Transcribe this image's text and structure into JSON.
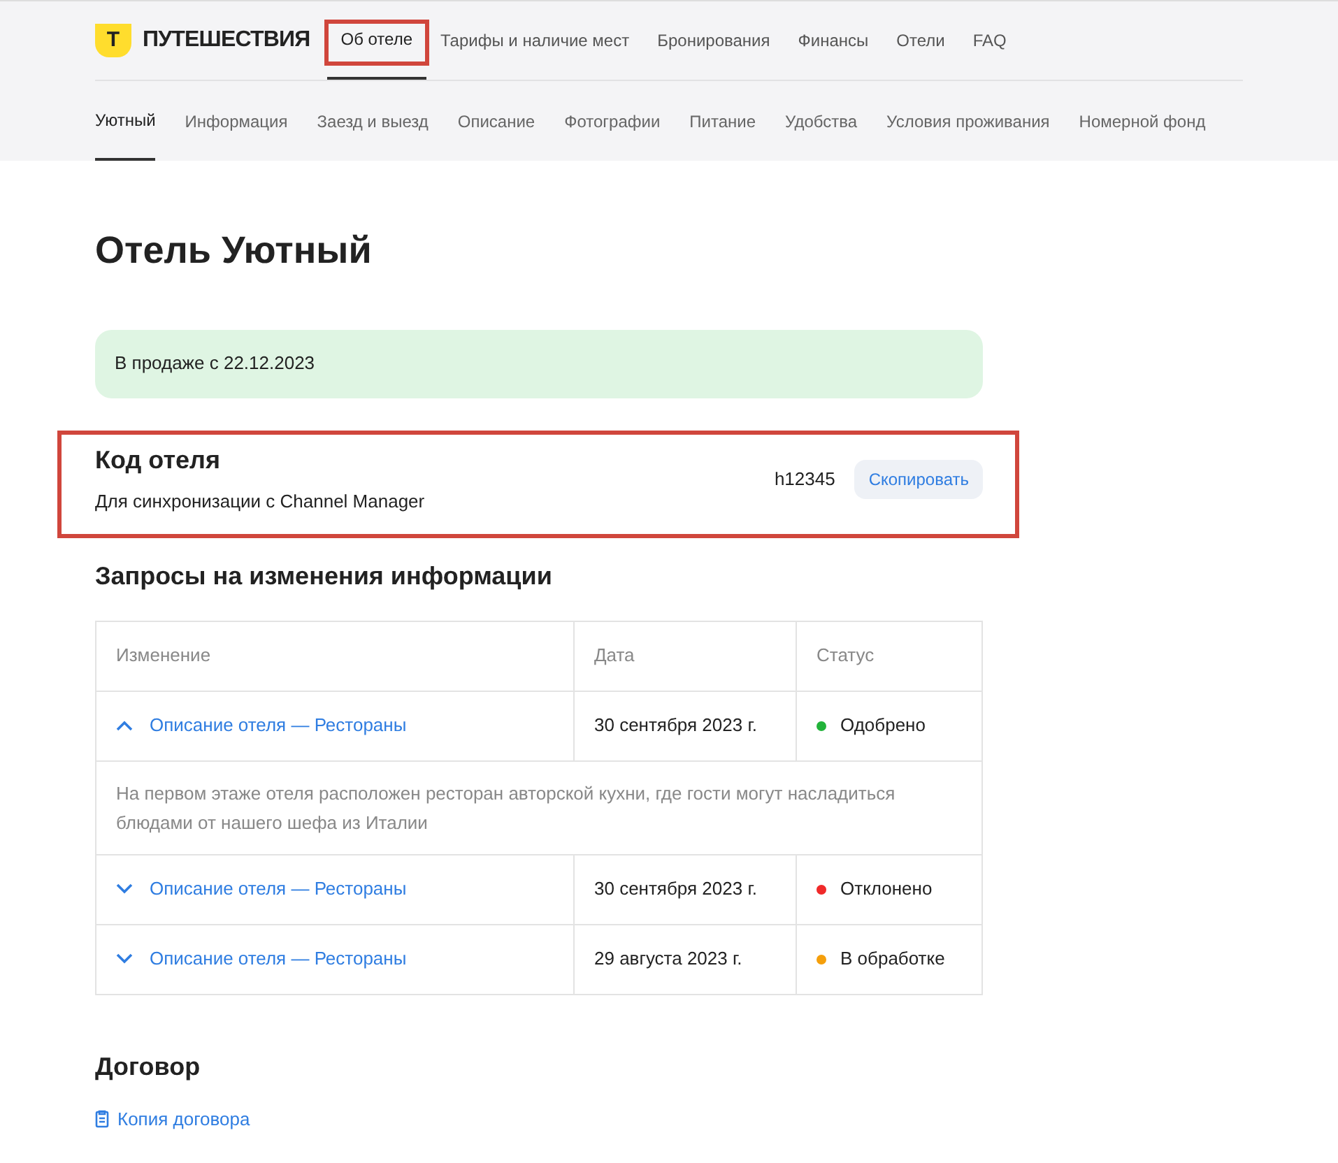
{
  "logo": {
    "mark": "Т",
    "text": "ПУТЕШЕСТВИЯ"
  },
  "top_nav": [
    {
      "label": "Об отеле",
      "selected": true,
      "highlighted": true
    },
    {
      "label": "Тарифы и наличие мест",
      "selected": false,
      "highlighted": false
    },
    {
      "label": "Бронирования",
      "selected": false,
      "highlighted": false
    },
    {
      "label": "Финансы",
      "selected": false,
      "highlighted": false
    },
    {
      "label": "Отели",
      "selected": false,
      "highlighted": false
    },
    {
      "label": "FAQ",
      "selected": false,
      "highlighted": false
    }
  ],
  "sub_nav": [
    {
      "label": "Уютный",
      "selected": true
    },
    {
      "label": "Информация",
      "selected": false
    },
    {
      "label": "Заезд и выезд",
      "selected": false
    },
    {
      "label": "Описание",
      "selected": false
    },
    {
      "label": "Фотографии",
      "selected": false
    },
    {
      "label": "Питание",
      "selected": false
    },
    {
      "label": "Удобства",
      "selected": false
    },
    {
      "label": "Условия проживания",
      "selected": false
    },
    {
      "label": "Номерной фонд",
      "selected": false
    }
  ],
  "title": "Отель Уютный",
  "sale_notice": "В продаже с 22.12.2023",
  "hotel_code": {
    "title": "Код отеля",
    "subtitle": "Для синхронизации с Channel Manager",
    "code": "h12345",
    "button": "Скопировать",
    "highlighted": true
  },
  "requests": {
    "title": "Запросы на изменения информации",
    "columns": [
      "Изменение",
      "Дата",
      "Статус"
    ],
    "rows": [
      {
        "change": "Описание отеля — Рестораны",
        "expanded": true,
        "date": "30 сентября 2023 г.",
        "status": "Одобрено",
        "color": "#22b33a",
        "details": "На первом этаже отеля расположен ресторан авторской кухни, где гости могут насладиться блюдами от нашего шефа из Италии"
      },
      {
        "change": "Описание отеля — Рестораны",
        "expanded": false,
        "date": "30 сентября 2023 г.",
        "status": "Отклонено",
        "color": "#f02a2a"
      },
      {
        "change": "Описание отеля — Рестораны",
        "expanded": false,
        "date": "29 августа 2023 г.",
        "status": "В обработке",
        "color": "#f59f0b"
      }
    ]
  },
  "contract": {
    "title": "Договор",
    "link": "Копия договора"
  }
}
